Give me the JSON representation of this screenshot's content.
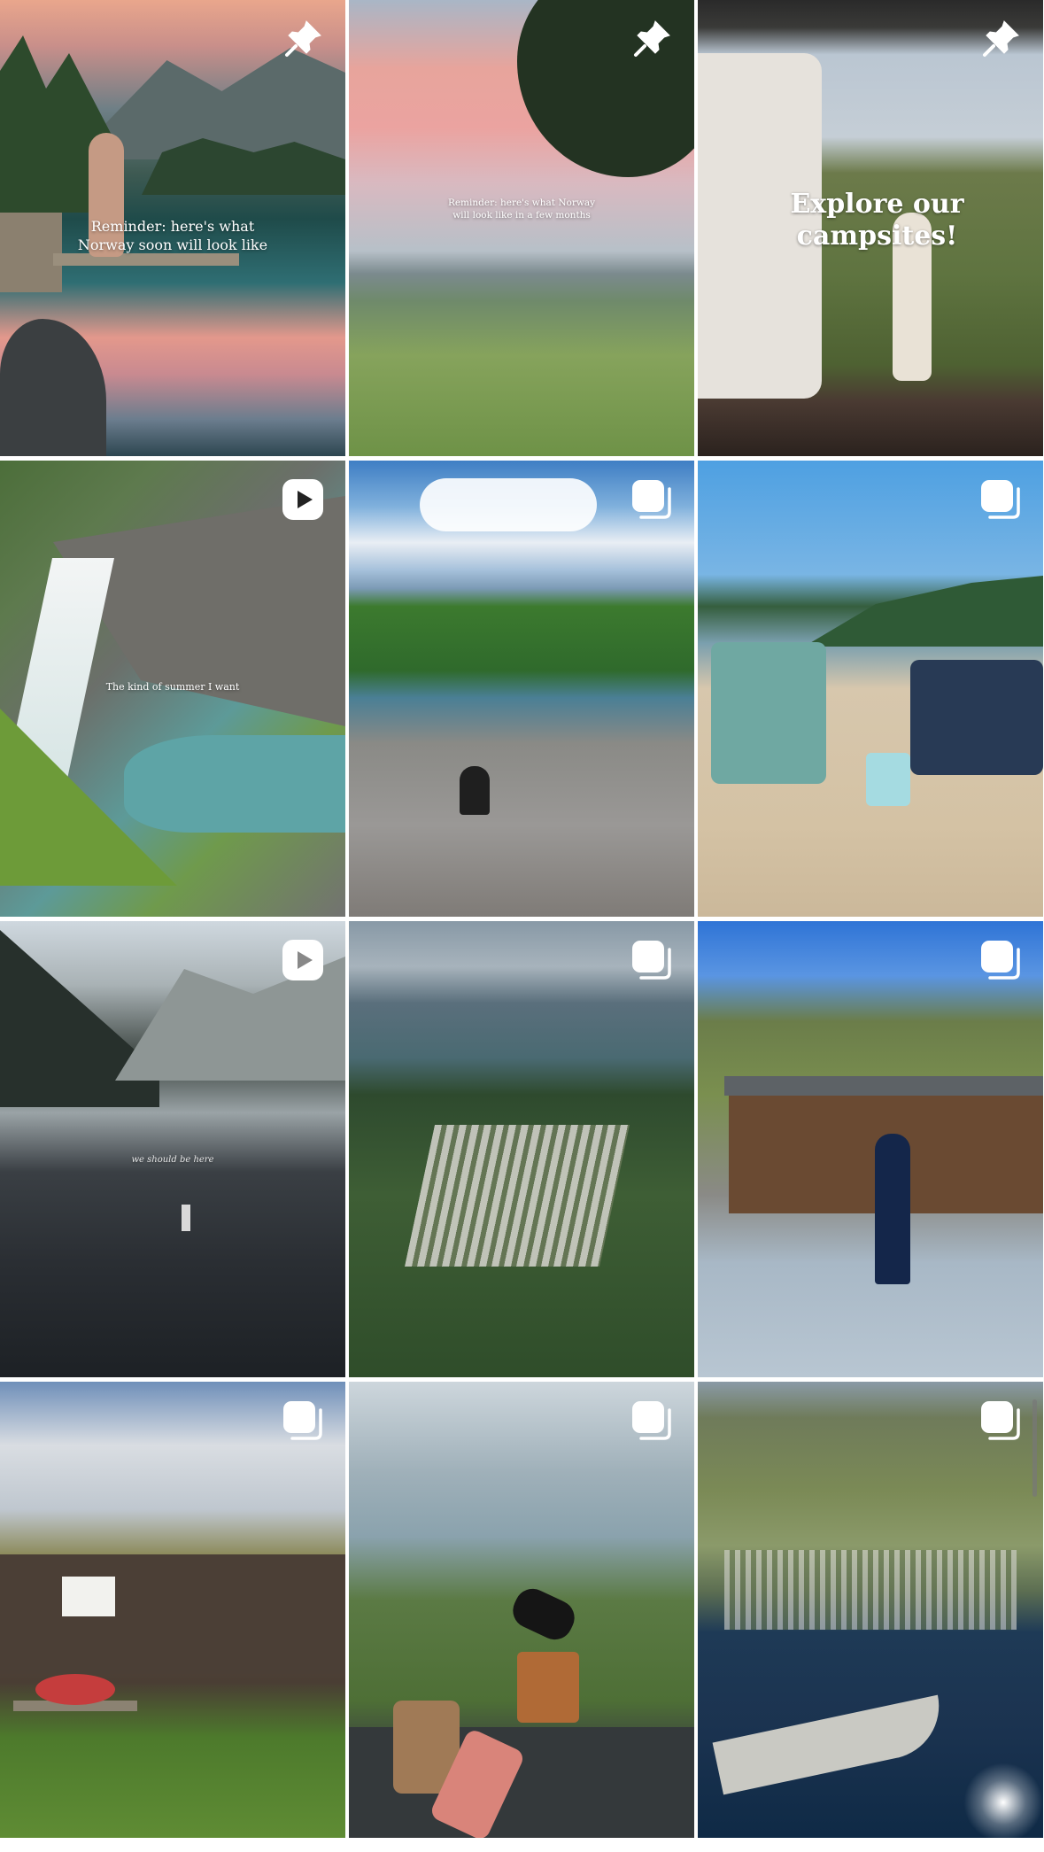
{
  "grid": {
    "posts": [
      {
        "id": "post-1",
        "kind": "pinned",
        "icon": "pin-icon",
        "caption": "Reminder: here's what Norway soon will look like"
      },
      {
        "id": "post-2",
        "kind": "pinned",
        "icon": "pin-icon",
        "caption": "Reminder: here's what Norway will look like in a few months"
      },
      {
        "id": "post-3",
        "kind": "pinned",
        "icon": "pin-icon",
        "caption": "Explore our campsites!"
      },
      {
        "id": "post-4",
        "kind": "reel",
        "icon": "reel-icon",
        "caption": "The kind of summer I want"
      },
      {
        "id": "post-5",
        "kind": "carousel",
        "icon": "carousel-icon",
        "caption": ""
      },
      {
        "id": "post-6",
        "kind": "carousel",
        "icon": "carousel-icon",
        "caption": ""
      },
      {
        "id": "post-7",
        "kind": "reel",
        "icon": "reel-icon",
        "caption": "we should be here"
      },
      {
        "id": "post-8",
        "kind": "carousel",
        "icon": "carousel-icon",
        "caption": ""
      },
      {
        "id": "post-9",
        "kind": "carousel",
        "icon": "carousel-icon",
        "caption": ""
      },
      {
        "id": "post-10",
        "kind": "carousel",
        "icon": "carousel-icon",
        "caption": ""
      },
      {
        "id": "post-11",
        "kind": "carousel",
        "icon": "carousel-icon",
        "caption": ""
      },
      {
        "id": "post-12",
        "kind": "carousel",
        "icon": "carousel-icon",
        "caption": ""
      }
    ]
  }
}
